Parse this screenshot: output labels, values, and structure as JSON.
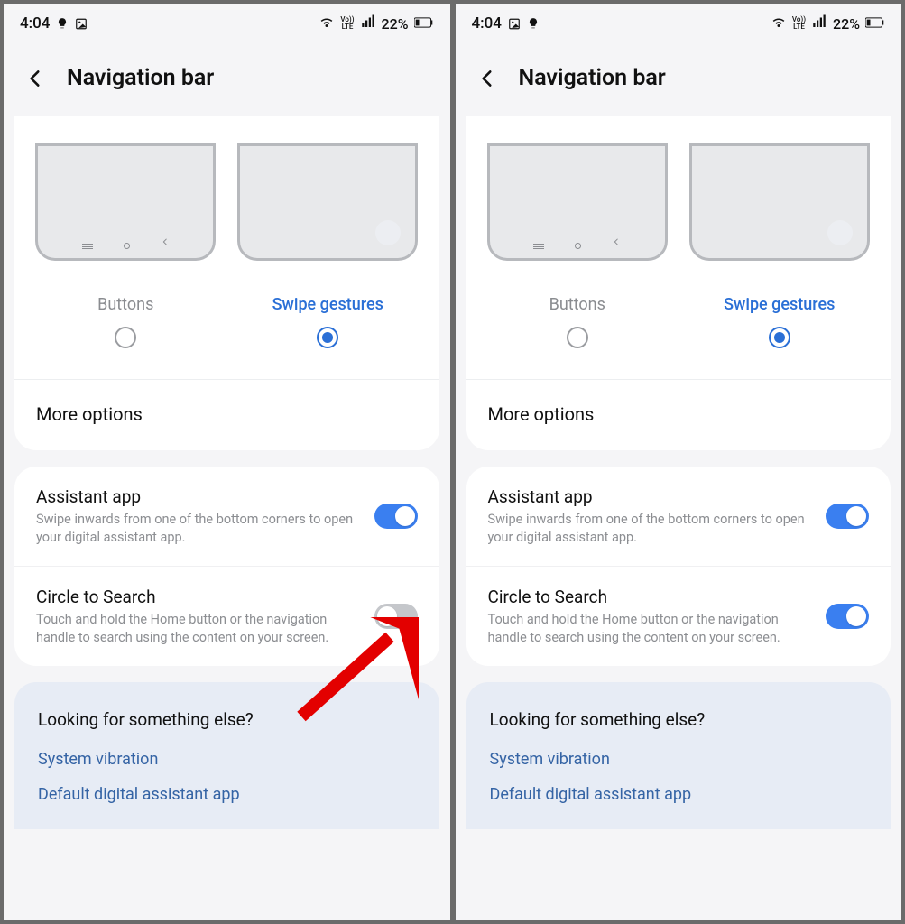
{
  "screens": [
    {
      "status": {
        "time": "4:04",
        "battery": "22%"
      },
      "title": "Navigation bar",
      "nav_types": [
        {
          "label": "Buttons",
          "selected": false
        },
        {
          "label": "Swipe gestures",
          "selected": true
        }
      ],
      "more_options": "More options",
      "toggles": [
        {
          "title": "Assistant app",
          "sub": "Swipe inwards from one of the bottom corners to open your digital assistant app.",
          "on": true
        },
        {
          "title": "Circle to Search",
          "sub": "Touch and hold the Home button or the navigation handle to search using the content on your screen.",
          "on": false
        }
      ],
      "footer": {
        "title": "Looking for something else?",
        "links": [
          "System vibration",
          "Default digital assistant app"
        ]
      },
      "show_arrow": true
    },
    {
      "status": {
        "time": "4:04",
        "battery": "22%"
      },
      "title": "Navigation bar",
      "nav_types": [
        {
          "label": "Buttons",
          "selected": false
        },
        {
          "label": "Swipe gestures",
          "selected": true
        }
      ],
      "more_options": "More options",
      "toggles": [
        {
          "title": "Assistant app",
          "sub": "Swipe inwards from one of the bottom corners to open your digital assistant app.",
          "on": true
        },
        {
          "title": "Circle to Search",
          "sub": "Touch and hold the Home button or the navigation handle to search using the content on your screen.",
          "on": true
        }
      ],
      "footer": {
        "title": "Looking for something else?",
        "links": [
          "System vibration",
          "Default digital assistant app"
        ]
      },
      "show_arrow": false
    }
  ]
}
